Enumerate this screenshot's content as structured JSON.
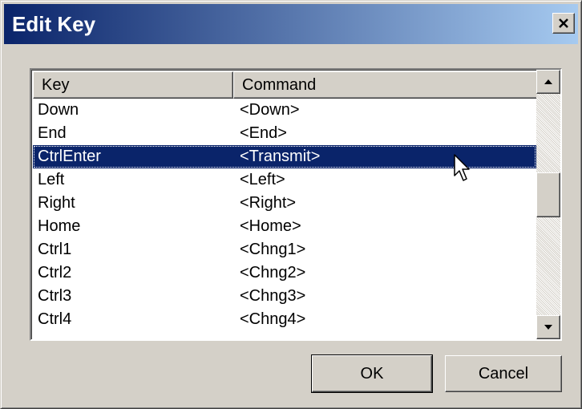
{
  "window": {
    "title": "Edit Key",
    "close_icon": "close-icon",
    "title_gradient": [
      "#0a246a",
      "#a6caf0"
    ]
  },
  "list": {
    "columns": [
      "Key",
      "Command"
    ],
    "rows": [
      {
        "key": "Down",
        "command": "<Down>"
      },
      {
        "key": "End",
        "command": "<End>"
      },
      {
        "key": "CtrlEnter",
        "command": "<Transmit>",
        "selected": true
      },
      {
        "key": "Left",
        "command": "<Left>"
      },
      {
        "key": "Right",
        "command": "<Right>"
      },
      {
        "key": "Home",
        "command": "<Home>"
      },
      {
        "key": "Ctrl1",
        "command": "<Chng1>"
      },
      {
        "key": "Ctrl2",
        "command": "<Chng2>"
      },
      {
        "key": "Ctrl3",
        "command": "<Chng3>"
      },
      {
        "key": "Ctrl4",
        "command": "<Chng4>"
      }
    ],
    "selection_color": "#0a246a"
  },
  "buttons": {
    "ok": "OK",
    "cancel": "Cancel"
  },
  "icons": {
    "scroll_up": "scroll-up-arrow-icon",
    "scroll_down": "scroll-down-arrow-icon",
    "cursor": "mouse-pointer-icon"
  }
}
